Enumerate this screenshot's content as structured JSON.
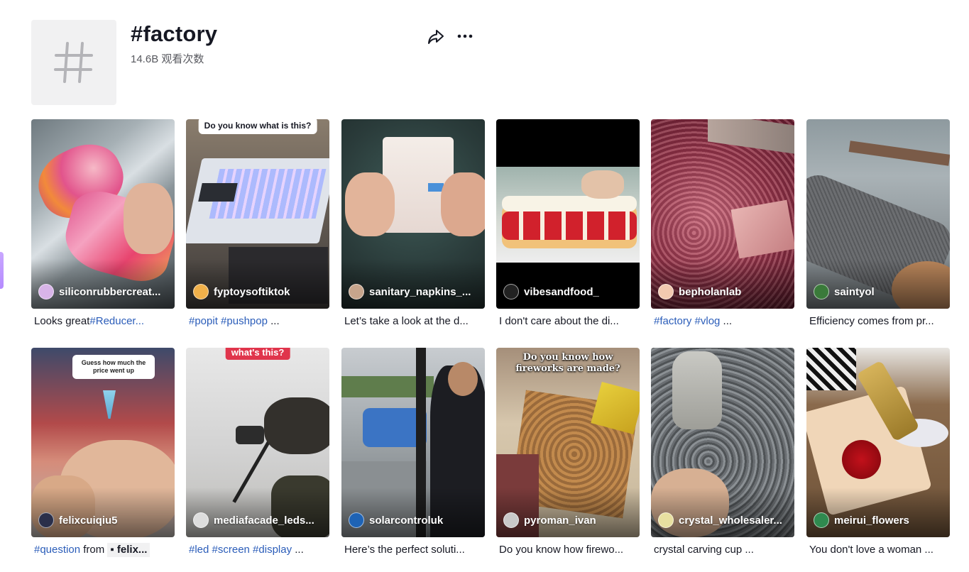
{
  "header": {
    "title": "#factory",
    "views": "14.6B 观看次数",
    "share_icon": "share-icon",
    "more_icon": "more-icon"
  },
  "videos": [
    {
      "author": "siliconrubbercreat...",
      "caption_tag": "",
      "caption_text": "Looks great",
      "caption_tag2": "#Reducer...",
      "avatar_color": "#d8b4e8"
    },
    {
      "author": "fyptoysoftiktok",
      "overlay": "Do you know what is this?",
      "caption_tag": "#popit #pushpop",
      "caption_text": " ...",
      "avatar_color": "#f0b04a"
    },
    {
      "author": "sanitary_napkins_...",
      "caption_tag": "",
      "caption_text": "Let’s take a look at the d...",
      "avatar_color": "#c7a58c"
    },
    {
      "author": "vibesandfood_",
      "caption_tag": "",
      "caption_text": "I don't care about the di...",
      "avatar_color": "#222222"
    },
    {
      "author": "bepholanlab",
      "caption_tag": "#factory #vlog",
      "caption_text": " ...",
      "avatar_color": "#f2c9b0"
    },
    {
      "author": "saintyol",
      "caption_tag": "",
      "caption_text": "Efficiency comes from pr...",
      "avatar_color": "#3a7a3a"
    },
    {
      "author": "felixcuiqiu5",
      "overlay": "Guess how much the price went up",
      "caption_tag": "#question",
      "caption_text": " from ",
      "caption_chip": "felix...",
      "avatar_color": "#2a2f4a"
    },
    {
      "author": "mediafacade_leds...",
      "overlay": "what's this?",
      "caption_tag": "#led #screen #display",
      "caption_text": " ...",
      "avatar_color": "#dddddd"
    },
    {
      "author": "solarcontroluk",
      "caption_tag": "",
      "caption_text": "Here’s the perfect soluti...",
      "avatar_color": "#1e63b5"
    },
    {
      "author": "pyroman_ivan",
      "overlay": "Do you know how fireworks are made?",
      "caption_tag": "",
      "caption_text": "Do you know how firewo...",
      "avatar_color": "#c9c9c9"
    },
    {
      "author": "crystal_wholesaler...",
      "caption_tag": "",
      "caption_text": "crystal carving cup ...",
      "avatar_color": "#e8e0a0"
    },
    {
      "author": "meirui_flowers",
      "caption_tag": "",
      "caption_text": "You don't love a woman ...",
      "avatar_color": "#2f8a4f"
    }
  ]
}
